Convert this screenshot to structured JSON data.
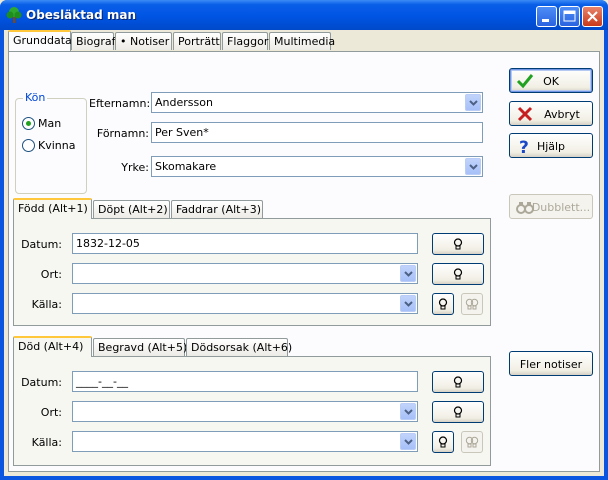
{
  "window": {
    "title": "Obesläktad man"
  },
  "main_tabs": [
    {
      "label": "Grunddata",
      "active": true
    },
    {
      "label": "Biografi"
    },
    {
      "label": "• Notiser"
    },
    {
      "label": "Porträtt"
    },
    {
      "label": "Flaggor"
    },
    {
      "label": "Multimedia"
    }
  ],
  "kon": {
    "group_label": "Kön",
    "man_label": "Man",
    "kvinna_label": "Kvinna",
    "selected": "Man"
  },
  "person": {
    "efternamn_label": "Efternamn:",
    "efternamn_value": "Andersson",
    "fornamn_label": "Förnamn:",
    "fornamn_value": "Per Sven*",
    "yrke_label": "Yrke:",
    "yrke_value": "Skomakare"
  },
  "buttons": {
    "ok": "OK",
    "avbryt": "Avbryt",
    "hjalp": "Hjälp",
    "dubblett": "Dubblett...",
    "fler_notiser": "Fler notiser"
  },
  "fodd": {
    "tabs": [
      {
        "label": "Född  (Alt+1)",
        "active": true
      },
      {
        "label": "Döpt  (Alt+2)"
      },
      {
        "label": "Faddrar  (Alt+3)"
      }
    ],
    "datum_label": "Datum:",
    "datum_value": "1832-12-05",
    "ort_label": "Ort:",
    "ort_value": "",
    "kalla_label": "Källa:",
    "kalla_value": ""
  },
  "dod": {
    "tabs": [
      {
        "label": "Död  (Alt+4)",
        "active": true
      },
      {
        "label": "Begravd  (Alt+5)"
      },
      {
        "label": "Dödsorsak  (Alt+6)"
      }
    ],
    "datum_label": "Datum:",
    "datum_value": "____-__-__",
    "ort_label": "Ort:",
    "ort_value": "",
    "kalla_label": "Källa:",
    "kalla_value": ""
  },
  "colors": {
    "titlebar": "#0054E3",
    "tab_highlight": "#FFC83C",
    "ok_check": "#21A121",
    "cancel_x": "#C62020",
    "help_q": "#1848C8"
  },
  "icons": {
    "app": "tree-icon",
    "ok": "checkmark-icon",
    "cancel": "x-icon",
    "help": "question-mark-icon",
    "dubblett": "binoculars-icon",
    "lookup": "lightbulb-icon"
  }
}
